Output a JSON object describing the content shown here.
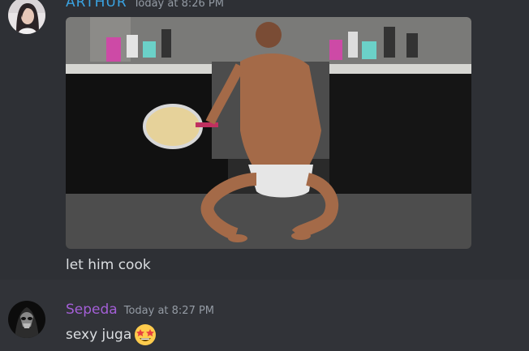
{
  "messages": [
    {
      "username": "ARTHUR",
      "timestamp": "Today at 8:26 PM",
      "attachment": "gif",
      "text": "let him cook"
    },
    {
      "username": "Sepeda",
      "timestamp": "Today at 8:27 PM",
      "text": "sexy juga",
      "emoji": "star-struck-emoji"
    }
  ],
  "colors": {
    "background": "#313338",
    "hover_background": "#2e3035",
    "username_1": "#3aa2e0",
    "username_2": "#a35fd6",
    "timestamp": "#949ba4",
    "text": "#dbdee1"
  }
}
